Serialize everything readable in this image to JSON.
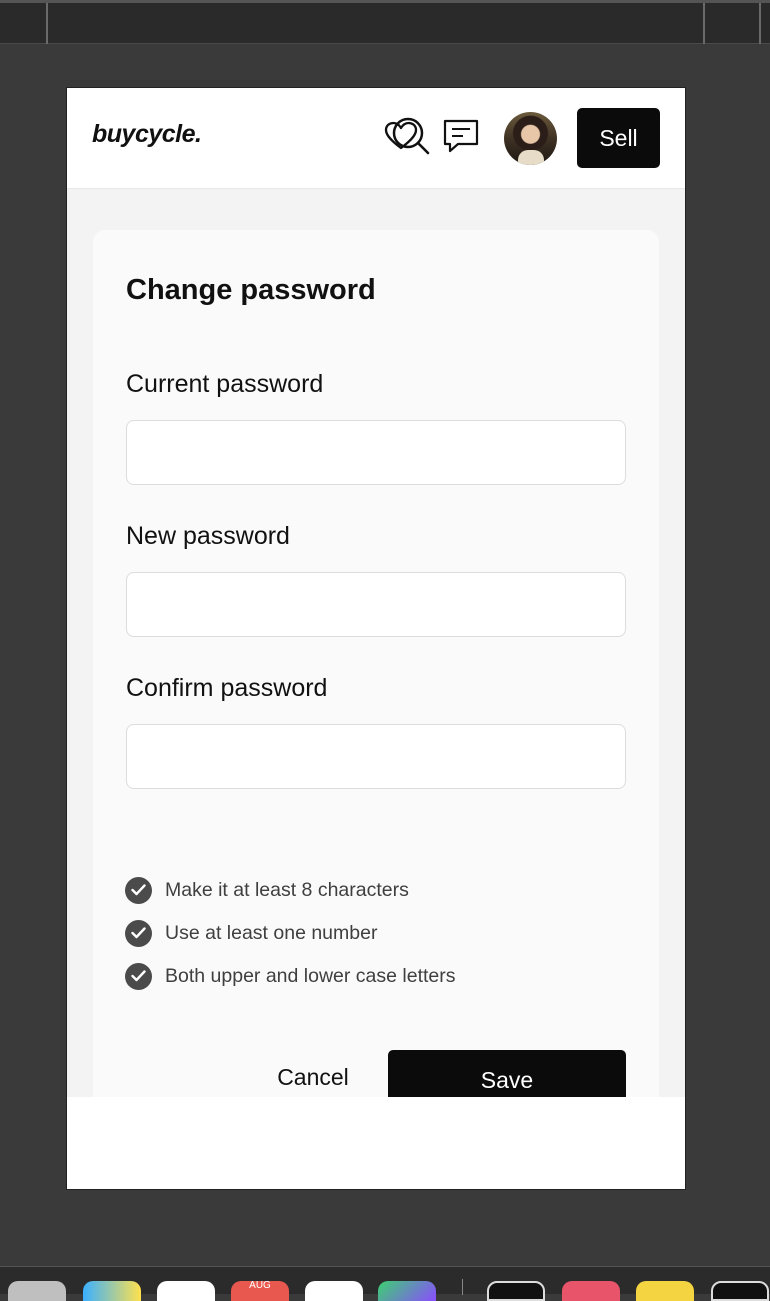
{
  "header": {
    "logo": "buycycle.",
    "sell_label": "Sell",
    "icons": [
      "search-icon",
      "heart-icon",
      "chat-icon"
    ]
  },
  "form": {
    "title": "Change password",
    "fields": [
      {
        "label": "Current password",
        "value": ""
      },
      {
        "label": "New password",
        "value": ""
      },
      {
        "label": "Confirm password",
        "value": ""
      }
    ],
    "rules": [
      "Make it at least 8 characters",
      "Use at least one number",
      "Both upper and lower case letters"
    ],
    "cancel_label": "Cancel",
    "save_label": "Save"
  },
  "dock": {
    "calendar_month": "AUG"
  },
  "colors": {
    "primary": "#0b0b0b",
    "page_bg": "#f3f3f3",
    "card_bg": "#fafafa",
    "check": "#4b4b4b"
  }
}
